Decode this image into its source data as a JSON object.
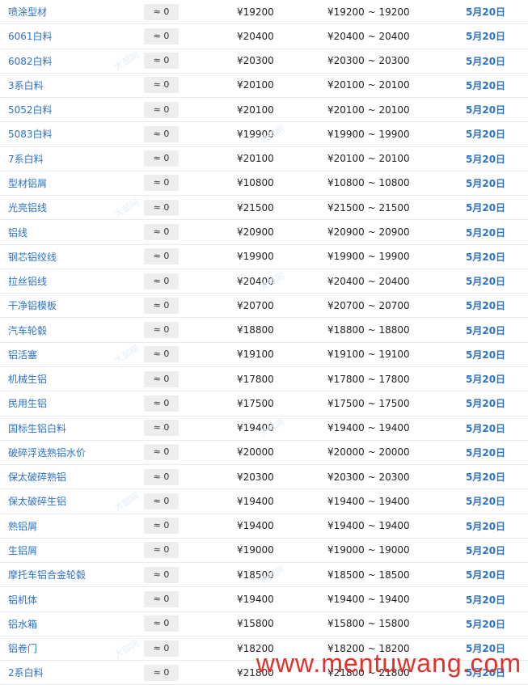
{
  "currency_symbol": "¥",
  "colors": {
    "link": "#2a72c8",
    "watermark": "#e0312b"
  },
  "faint_watermark_text": "大部网",
  "rows": [
    {
      "name": "喷涂型材",
      "change": "≈ 0",
      "price": "¥19200",
      "range": "¥19200 ~ 19200",
      "date": "5月20日"
    },
    {
      "name": "6061白料",
      "change": "≈ 0",
      "price": "¥20400",
      "range": "¥20400 ~ 20400",
      "date": "5月20日"
    },
    {
      "name": "6082白料",
      "change": "≈ 0",
      "price": "¥20300",
      "range": "¥20300 ~ 20300",
      "date": "5月20日"
    },
    {
      "name": "3系白料",
      "change": "≈ 0",
      "price": "¥20100",
      "range": "¥20100 ~ 20100",
      "date": "5月20日"
    },
    {
      "name": "5052白料",
      "change": "≈ 0",
      "price": "¥20100",
      "range": "¥20100 ~ 20100",
      "date": "5月20日"
    },
    {
      "name": "5083白料",
      "change": "≈ 0",
      "price": "¥19900",
      "range": "¥19900 ~ 19900",
      "date": "5月20日"
    },
    {
      "name": "7系白料",
      "change": "≈ 0",
      "price": "¥20100",
      "range": "¥20100 ~ 20100",
      "date": "5月20日"
    },
    {
      "name": "型材铝屑",
      "change": "≈ 0",
      "price": "¥10800",
      "range": "¥10800 ~ 10800",
      "date": "5月20日"
    },
    {
      "name": "光亮铝线",
      "change": "≈ 0",
      "price": "¥21500",
      "range": "¥21500 ~ 21500",
      "date": "5月20日"
    },
    {
      "name": "铝线",
      "change": "≈ 0",
      "price": "¥20900",
      "range": "¥20900 ~ 20900",
      "date": "5月20日"
    },
    {
      "name": "钢芯铝绞线",
      "change": "≈ 0",
      "price": "¥19900",
      "range": "¥19900 ~ 19900",
      "date": "5月20日"
    },
    {
      "name": "拉丝铝线",
      "change": "≈ 0",
      "price": "¥20400",
      "range": "¥20400 ~ 20400",
      "date": "5月20日"
    },
    {
      "name": "干净铝模板",
      "change": "≈ 0",
      "price": "¥20700",
      "range": "¥20700 ~ 20700",
      "date": "5月20日"
    },
    {
      "name": "汽车轮毂",
      "change": "≈ 0",
      "price": "¥18800",
      "range": "¥18800 ~ 18800",
      "date": "5月20日"
    },
    {
      "name": "铝活塞",
      "change": "≈ 0",
      "price": "¥19100",
      "range": "¥19100 ~ 19100",
      "date": "5月20日"
    },
    {
      "name": "机械生铝",
      "change": "≈ 0",
      "price": "¥17800",
      "range": "¥17800 ~ 17800",
      "date": "5月20日"
    },
    {
      "name": "民用生铝",
      "change": "≈ 0",
      "price": "¥17500",
      "range": "¥17500 ~ 17500",
      "date": "5月20日"
    },
    {
      "name": "国标生铝白料",
      "change": "≈ 0",
      "price": "¥19400",
      "range": "¥19400 ~ 19400",
      "date": "5月20日"
    },
    {
      "name": "破碎浮选熟铝水价",
      "change": "≈ 0",
      "price": "¥20000",
      "range": "¥20000 ~ 20000",
      "date": "5月20日"
    },
    {
      "name": "保太破碎熟铝",
      "change": "≈ 0",
      "price": "¥20300",
      "range": "¥20300 ~ 20300",
      "date": "5月20日"
    },
    {
      "name": "保太破碎生铝",
      "change": "≈ 0",
      "price": "¥19400",
      "range": "¥19400 ~ 19400",
      "date": "5月20日"
    },
    {
      "name": "熟铝屑",
      "change": "≈ 0",
      "price": "¥19400",
      "range": "¥19400 ~ 19400",
      "date": "5月20日"
    },
    {
      "name": "生铝屑",
      "change": "≈ 0",
      "price": "¥19000",
      "range": "¥19000 ~ 19000",
      "date": "5月20日"
    },
    {
      "name": "摩托车铝合金轮毂",
      "change": "≈ 0",
      "price": "¥18500",
      "range": "¥18500 ~ 18500",
      "date": "5月20日"
    },
    {
      "name": "铝机体",
      "change": "≈ 0",
      "price": "¥19400",
      "range": "¥19400 ~ 19400",
      "date": "5月20日"
    },
    {
      "name": "铝水箱",
      "change": "≈ 0",
      "price": "¥15800",
      "range": "¥15800 ~ 15800",
      "date": "5月20日"
    },
    {
      "name": "铝卷门",
      "change": "≈ 0",
      "price": "¥18200",
      "range": "¥18200 ~ 18200",
      "date": "5月20日"
    },
    {
      "name": "2系白料",
      "change": "≈ 0",
      "price": "¥21800",
      "range": "¥21800 ~ 21800",
      "date": "5月20日"
    }
  ],
  "watermark": "www.mentuwang.com"
}
